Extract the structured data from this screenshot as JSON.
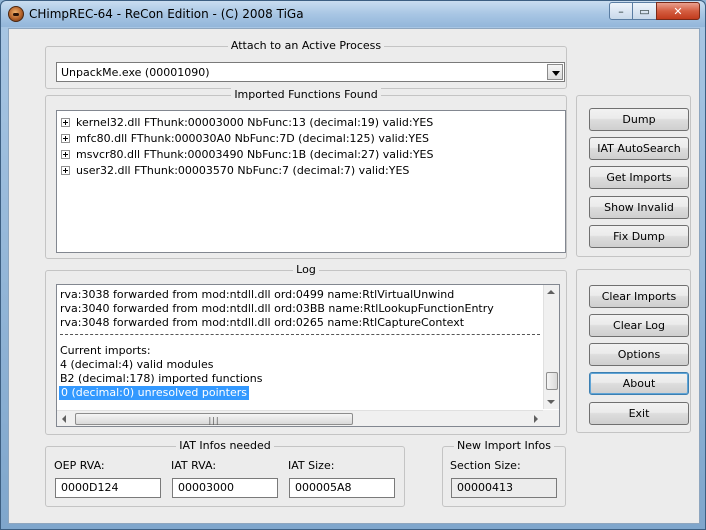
{
  "window": {
    "title": "CHimpREC-64 - ReCon Edition - (C) 2008 TiGa",
    "min_glyph": "–",
    "max_glyph": "▭",
    "close_glyph": "✕"
  },
  "attach": {
    "legend": "Attach to an Active Process",
    "selected_process": "UnpackMe.exe (00001090)"
  },
  "imports": {
    "legend": "Imported Functions Found",
    "items": [
      "kernel32.dll FThunk:00003000 NbFunc:13 (decimal:19) valid:YES",
      "mfc80.dll FThunk:000030A0 NbFunc:7D (decimal:125) valid:YES",
      "msvcr80.dll FThunk:00003490 NbFunc:1B (decimal:27) valid:YES",
      "user32.dll FThunk:00003570 NbFunc:7 (decimal:7) valid:YES"
    ]
  },
  "log": {
    "legend": "Log",
    "lines": [
      "rva:3038 forwarded from mod:ntdll.dll ord:0499 name:RtlVirtualUnwind",
      "rva:3040 forwarded from mod:ntdll.dll ord:03BB name:RtlLookupFunctionEntry",
      "rva:3048 forwarded from mod:ntdll.dll ord:0265 name:RtlCaptureContext",
      "Current imports:",
      "4 (decimal:4) valid modules",
      "B2 (decimal:178) imported functions",
      "0 (decimal:0) unresolved pointers"
    ]
  },
  "buttons_top": [
    "Dump",
    "IAT AutoSearch",
    "Get Imports",
    "Show Invalid",
    "Fix Dump"
  ],
  "buttons_bottom": [
    "Clear Imports",
    "Clear Log",
    "Options",
    "About",
    "Exit"
  ],
  "iat": {
    "legend": "IAT Infos needed",
    "oep_label": "OEP RVA:",
    "oep_value": "0000D124",
    "iat_rva_label": "IAT RVA:",
    "iat_rva_value": "00003000",
    "iat_size_label": "IAT Size:",
    "iat_size_value": "000005A8"
  },
  "new_import": {
    "legend": "New Import Infos",
    "section_size_label": "Section Size:",
    "section_size_value": "00000413"
  },
  "colors": {
    "selection": "#3399ff",
    "close_button": "#c13b1d"
  }
}
